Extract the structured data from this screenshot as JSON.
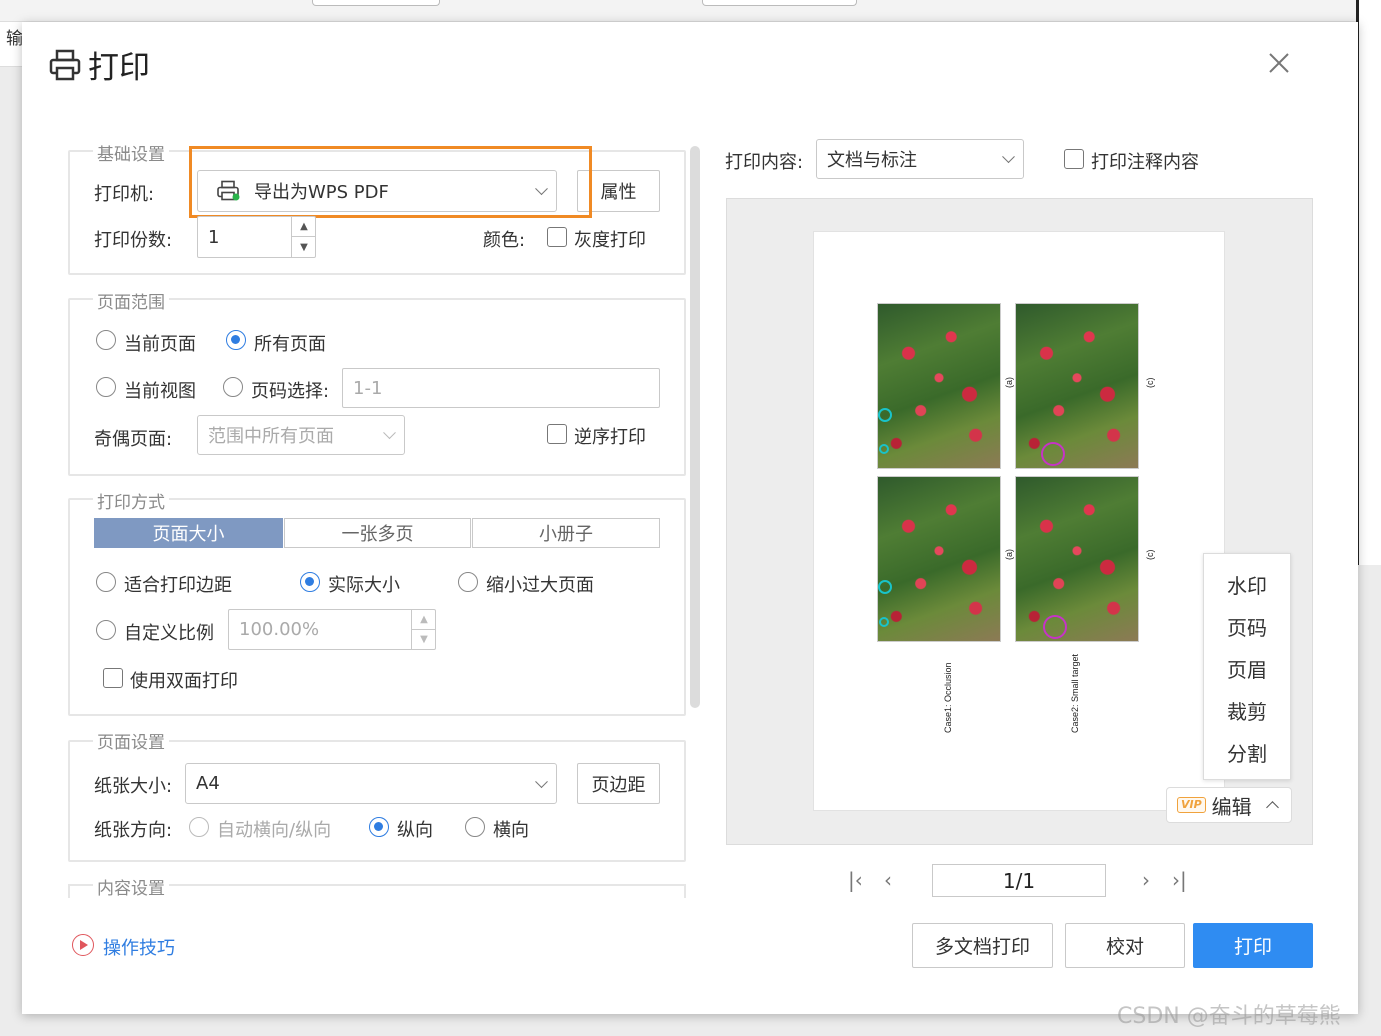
{
  "background_app": {
    "left_strip_char": "输"
  },
  "dialog": {
    "title": "打印",
    "close_icon": "close-icon"
  },
  "basic": {
    "legend": "基础设置",
    "printer_label": "打印机:",
    "printer_value": "导出为WPS PDF",
    "properties_button": "属性",
    "copies_label": "打印份数:",
    "copies_value": "1",
    "color_label": "颜色:",
    "grayscale_label": "灰度打印"
  },
  "range": {
    "legend": "页面范围",
    "current_page": "当前页面",
    "all_pages": "所有页面",
    "current_view": "当前视图",
    "page_select": "页码选择:",
    "page_select_value": "1-1",
    "odd_even_label": "奇偶页面:",
    "odd_even_value": "范围中所有页面",
    "reverse_label": "逆序打印"
  },
  "mode": {
    "legend": "打印方式",
    "tabs": [
      "页面大小",
      "一张多页",
      "小册子"
    ],
    "active_tab": "页面大小",
    "fit_margins": "适合打印边距",
    "actual_size": "实际大小",
    "shrink_large": "缩小过大页面",
    "custom_scale": "自定义比例",
    "custom_scale_value": "100.00%",
    "duplex_label": "使用双面打印"
  },
  "page_setup": {
    "legend": "页面设置",
    "paper_size_label": "纸张大小:",
    "paper_size_value": "A4",
    "margins_button": "页边距",
    "orientation_label": "纸张方向:",
    "auto_orientation": "自动横向/纵向",
    "portrait": "纵向",
    "landscape": "横向"
  },
  "content_setup": {
    "legend": "内容设置"
  },
  "preview": {
    "content_label": "打印内容:",
    "content_value": "文档与标注",
    "print_annotations_label": "打印注释内容",
    "panel_labels": [
      "(a)",
      "(c)",
      "(a)",
      "(c)"
    ],
    "captions": [
      "Case1: Occlusion",
      "Case2: Small target"
    ],
    "side_menu": [
      "水印",
      "页码",
      "页眉",
      "裁剪",
      "分割"
    ],
    "vip_badge": "VIP",
    "edit_label": "编辑",
    "page_indicator": "1/1"
  },
  "footer": {
    "tips_label": "操作技巧",
    "multi_doc_button": "多文档打印",
    "proof_button": "校对",
    "print_button": "打印"
  },
  "watermark": "CSDN @奋斗的草莓熊",
  "colors": {
    "accent": "#2f8cf2",
    "highlight_box": "#f08a24",
    "active_tab": "#7f99c2"
  }
}
